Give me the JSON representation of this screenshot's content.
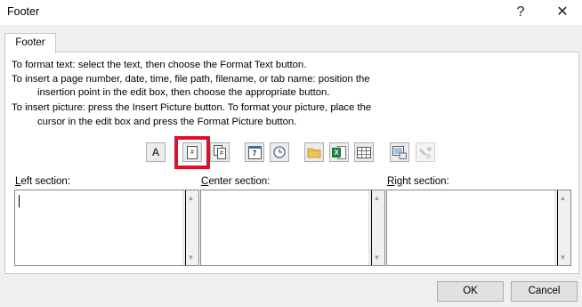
{
  "window": {
    "title": "Footer",
    "help_glyph": "?",
    "close_glyph": "✕"
  },
  "tabs": [
    {
      "label": "Footer"
    }
  ],
  "instructions": [
    "To format text:  select the text, then choose the Format Text button.",
    "To insert a page number, date, time, file path, filename, or tab name:  position the",
    "insertion point in the edit box, then choose the appropriate button.",
    "To insert picture: press the Insert Picture button.  To format your picture, place the",
    "cursor in the edit box and press the Format Picture button."
  ],
  "toolbar": {
    "format_text": {
      "glyph": "A",
      "icon": "format-text-icon"
    },
    "insert_page_number": {
      "glyph": "#",
      "icon": "page-number-icon"
    },
    "insert_number_of_pages": {
      "glyph": "#",
      "icon": "number-of-pages-icon"
    },
    "insert_date": {
      "glyph": "7",
      "icon": "calendar-icon"
    },
    "insert_time": {
      "icon": "clock-icon"
    },
    "insert_file_path": {
      "icon": "folder-icon"
    },
    "insert_file_name": {
      "glyph": "X",
      "icon": "excel-file-icon"
    },
    "insert_sheet_name": {
      "icon": "sheet-tab-icon"
    },
    "insert_picture": {
      "icon": "picture-icon"
    },
    "format_picture": {
      "icon": "format-picture-icon"
    },
    "highlight_color": "#e0102a"
  },
  "sections": {
    "left": {
      "label_access": "L",
      "label_rest": "eft section:"
    },
    "center": {
      "label_access": "C",
      "label_rest": "enter section:"
    },
    "right": {
      "label_access": "R",
      "label_rest": "ight section:"
    }
  },
  "buttons": {
    "ok": "OK",
    "cancel": "Cancel"
  }
}
